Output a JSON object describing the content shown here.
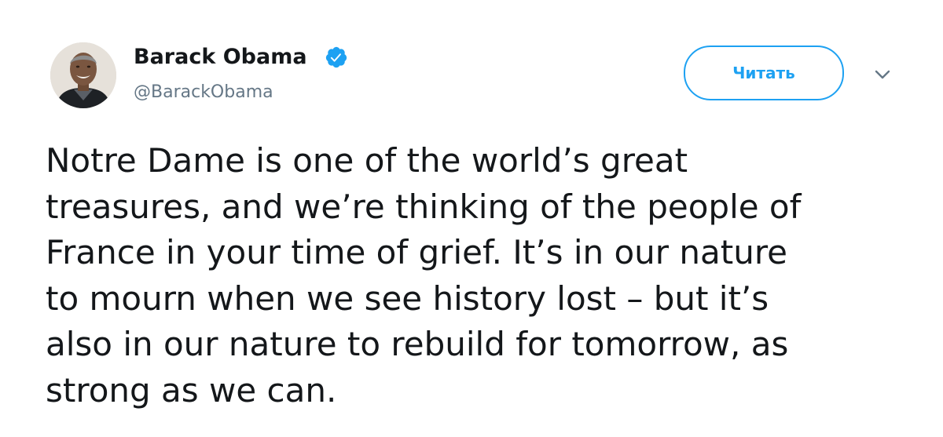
{
  "author": {
    "display_name": "Barack Obama",
    "handle": "@BarackObama",
    "verified": true,
    "avatar_icon": "profile-photo"
  },
  "actions": {
    "follow_label": "Читать",
    "menu_icon": "chevron-down-icon"
  },
  "tweet": {
    "lines": [
      "Notre Dame is one of the world’s great",
      "treasures, and we’re thinking of the people of",
      "France in your time of grief. It’s in our nature",
      "to mourn when we see history lost – but it’s",
      "also in our nature to rebuild for tomorrow, as",
      "strong as we can."
    ]
  },
  "colors": {
    "accent": "#1da1f2",
    "text": "#14171a",
    "muted": "#657786"
  }
}
